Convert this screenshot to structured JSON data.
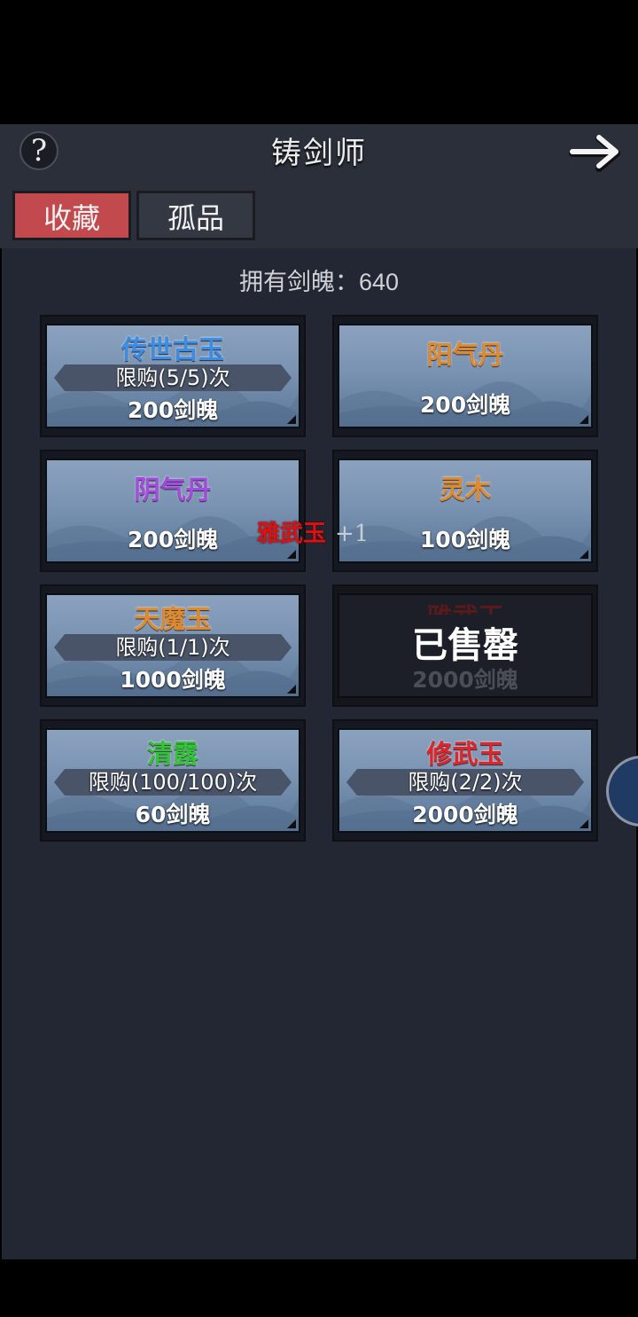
{
  "header": {
    "title": "铸剑师",
    "help_icon": "?",
    "back_icon": "arrow-right-icon"
  },
  "tabs": [
    {
      "label": "收藏",
      "active": true
    },
    {
      "label": "孤品",
      "active": false
    }
  ],
  "currency": {
    "text": "拥有剑魄：640"
  },
  "items": [
    {
      "name": "传世古玉",
      "name_color": "#3a8ee6",
      "limit": "限购(5/5)次",
      "price": "200剑魄"
    },
    {
      "name": "阳气丹",
      "name_color": "#e08a2e",
      "limit": "",
      "price": "200剑魄"
    },
    {
      "name": "阴气丹",
      "name_color": "#a44be0",
      "limit": "",
      "price": "200剑魄"
    },
    {
      "name": "灵木",
      "name_color": "#e08a2e",
      "limit": "",
      "price": "100剑魄"
    },
    {
      "name": "天魔玉",
      "name_color": "#e08a2e",
      "limit": "限购(1/1)次",
      "price": "1000剑魄"
    },
    {
      "name": "雅武玉",
      "name_color": "#5b1a1a",
      "limit": "",
      "price": "2000剑魄",
      "sold_label": "已售罄"
    },
    {
      "name": "清露",
      "name_color": "#35c23c",
      "limit": "限购(100/100)次",
      "price": "60剑魄"
    },
    {
      "name": "修武玉",
      "name_color": "#e0262a",
      "limit": "限购(2/2)次",
      "price": "2000剑魄"
    }
  ],
  "floating_reward": {
    "name": "雅武玉",
    "amount": "+1"
  }
}
